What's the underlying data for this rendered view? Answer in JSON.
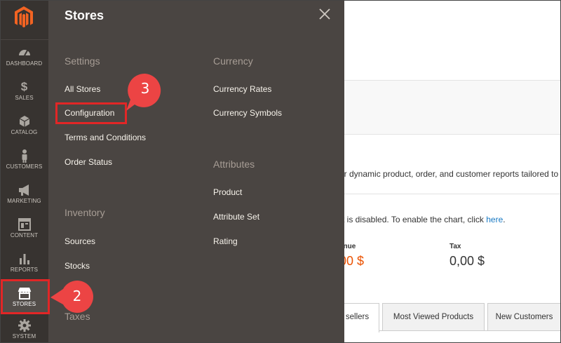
{
  "nav": {
    "items": [
      {
        "label": "DASHBOARD",
        "icon": "gauge-icon"
      },
      {
        "label": "SALES",
        "icon": "dollar-icon"
      },
      {
        "label": "CATALOG",
        "icon": "cube-icon"
      },
      {
        "label": "CUSTOMERS",
        "icon": "person-icon"
      },
      {
        "label": "MARKETING",
        "icon": "megaphone-icon"
      },
      {
        "label": "CONTENT",
        "icon": "layout-icon"
      },
      {
        "label": "REPORTS",
        "icon": "bar-chart-icon"
      },
      {
        "label": "STORES",
        "icon": "storefront-icon"
      },
      {
        "label": "SYSTEM",
        "icon": "gear-icon"
      }
    ],
    "active": "STORES"
  },
  "flyout": {
    "title": "Stores",
    "settings": {
      "heading": "Settings",
      "links": [
        "All Stores",
        "Configuration",
        "Terms and Conditions",
        "Order Status"
      ]
    },
    "inventory": {
      "heading": "Inventory",
      "links": [
        "Sources",
        "Stocks"
      ]
    },
    "taxes": {
      "heading": "Taxes"
    },
    "currency": {
      "heading": "Currency",
      "links": [
        "Currency Rates",
        "Currency Symbols"
      ]
    },
    "attributes": {
      "heading": "Attributes",
      "links": [
        "Product",
        "Attribute Set",
        "Rating"
      ]
    }
  },
  "callouts": {
    "stores": "2",
    "configuration": "3"
  },
  "background": {
    "reports_text": "ur dynamic product, order, and customer reports tailored to",
    "chart_text": "rt is disabled. To enable the chart, click ",
    "chart_link": "here",
    "chart_end": ".",
    "revenue_label": "enue",
    "revenue_value": "00 $",
    "tax_label": "Tax",
    "tax_value": "0,00 $",
    "tabs": [
      "sellers",
      "Most Viewed Products",
      "New Customers"
    ]
  },
  "colors": {
    "nav_bg": "#373330",
    "flyout_bg": "#4a4542",
    "highlight": "#e22626",
    "callout": "#ec4444",
    "accent_orange": "#eb5202",
    "link_blue": "#1979c3"
  }
}
